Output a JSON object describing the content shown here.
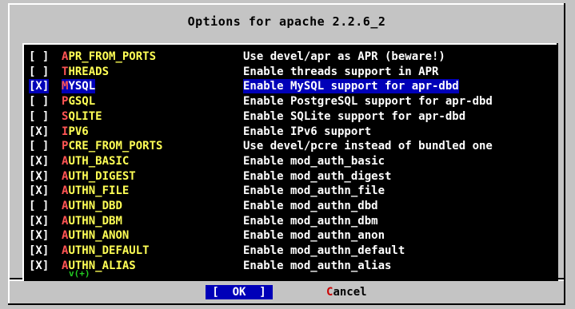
{
  "dialog": {
    "title": "Options for apache 2.2.6_2"
  },
  "options": [
    {
      "check": "[ ]",
      "first": "A",
      "rest": "PR_FROM_PORTS",
      "desc": "Use devel/apr as APR (beware!)",
      "selected": false
    },
    {
      "check": "[ ]",
      "first": "T",
      "rest": "HREADS",
      "desc": "Enable threads support in APR",
      "selected": false
    },
    {
      "check": "[X]",
      "first": "M",
      "rest": "YSQL",
      "desc": "Enable MySQL support for apr-dbd",
      "selected": true
    },
    {
      "check": "[ ]",
      "first": "P",
      "rest": "GSQL",
      "desc": "Enable PostgreSQL support for apr-dbd",
      "selected": false
    },
    {
      "check": "[ ]",
      "first": "S",
      "rest": "QLITE",
      "desc": "Enable SQLite support for apr-dbd",
      "selected": false
    },
    {
      "check": "[X]",
      "first": "I",
      "rest": "PV6",
      "desc": "Enable IPv6 support",
      "selected": false
    },
    {
      "check": "[ ]",
      "first": "P",
      "rest": "CRE_FROM_PORTS",
      "desc": "Use devel/pcre instead of bundled one",
      "selected": false
    },
    {
      "check": "[X]",
      "first": "A",
      "rest": "UTH_BASIC",
      "desc": "Enable mod_auth_basic",
      "selected": false
    },
    {
      "check": "[X]",
      "first": "A",
      "rest": "UTH_DIGEST",
      "desc": "Enable mod_auth_digest",
      "selected": false
    },
    {
      "check": "[X]",
      "first": "A",
      "rest": "UTHN_FILE",
      "desc": "Enable mod_authn_file",
      "selected": false
    },
    {
      "check": "[ ]",
      "first": "A",
      "rest": "UTHN_DBD",
      "desc": "Enable mod_authn_dbd",
      "selected": false
    },
    {
      "check": "[X]",
      "first": "A",
      "rest": "UTHN_DBM",
      "desc": "Enable mod_authn_dbm",
      "selected": false
    },
    {
      "check": "[X]",
      "first": "A",
      "rest": "UTHN_ANON",
      "desc": "Enable mod_authn_anon",
      "selected": false
    },
    {
      "check": "[X]",
      "first": "A",
      "rest": "UTHN_DEFAULT",
      "desc": "Enable mod_authn_default",
      "selected": false
    },
    {
      "check": "[X]",
      "first": "A",
      "rest": "UTHN_ALIAS",
      "desc": "Enable mod_authn_alias",
      "selected": false
    }
  ],
  "scroll_indicator": "v(+)",
  "buttons": {
    "ok": "[  OK  ]",
    "cancel_first": "C",
    "cancel_rest": "ancel"
  },
  "colors": {
    "background": "#c4c4c4",
    "selection": "#0000b8",
    "item_name": "#ffff55",
    "hotkey": "#ff5555"
  }
}
